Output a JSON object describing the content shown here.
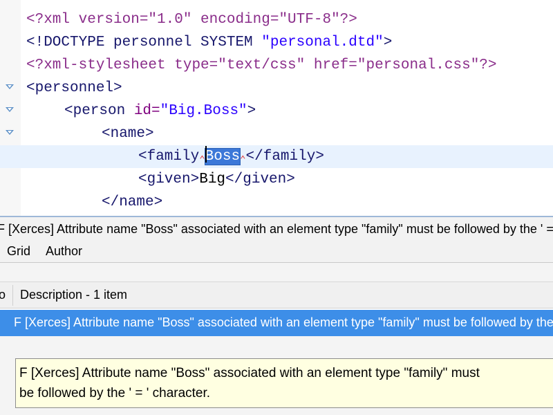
{
  "editor": {
    "line1": {
      "pi": "<?xml version=\"1.0\" encoding=\"UTF-8\"?>"
    },
    "line2": {
      "open": "<!DOCTYPE personnel SYSTEM ",
      "val": "\"personal.dtd\"",
      "close": ">"
    },
    "line3": {
      "pi": "<?xml-stylesheet type=\"text/css\" href=\"personal.css\"?>"
    },
    "line4": {
      "tag": "<personnel>"
    },
    "line5": {
      "open": "<person ",
      "attr": "id=",
      "val": "\"Big.Boss\"",
      "close": ">"
    },
    "line6": {
      "tag": "<name>"
    },
    "line7": {
      "open": "<family",
      "mark1": "⌃",
      "selected": "Boss",
      "mark2": "⌃",
      "close": "</family>"
    },
    "line8": {
      "open": "<given>",
      "text": "Big",
      "close": "</given>"
    },
    "line9": {
      "tag": "</name>"
    }
  },
  "status_line": "F [Xerces] Attribute name \"Boss\" associated with an element type \"family\" must be followed by the ' = ' character.",
  "tabs": [
    "Grid",
    "Author"
  ],
  "problems": {
    "col_first": "o",
    "col_description": "Description - 1 item",
    "row_text": "F [Xerces] Attribute name \"Boss\" associated with an element type \"family\" must be followed by the ' = ' character."
  },
  "tooltip": {
    "line1": "F [Xerces] Attribute name \"Boss\" associated with an element type \"family\" must",
    "line2": "be followed by the ' = ' character."
  },
  "colors": {
    "selection": "#3c78d8",
    "problem_row": "#3d8ee8",
    "tooltip_bg": "#ffffe1",
    "tag": "#16166b",
    "attr_value": "#2a00ff",
    "processing_instruction": "#8a2d8a"
  },
  "icons": [
    "fold-arrow-icon",
    "error-marker-icon"
  ]
}
